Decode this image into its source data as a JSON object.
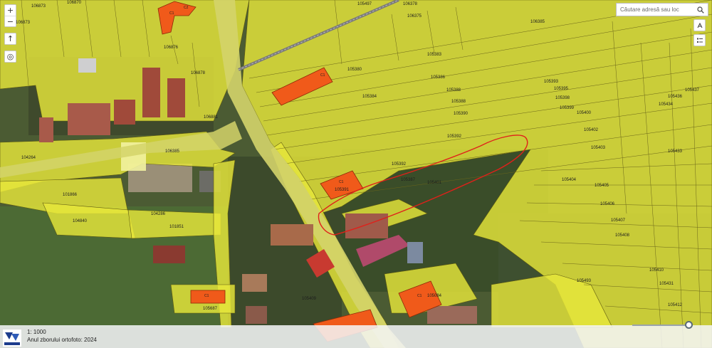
{
  "toolbar": {
    "zoom_in": "+",
    "zoom_out": "−",
    "compass": "↑",
    "locate": "◎"
  },
  "search": {
    "placeholder": "Căutare adresă sau loc"
  },
  "icons": {
    "search": "search-icon",
    "share": "share-icon",
    "layers": "layer-list-icon",
    "logo": "ancpi-logo"
  },
  "bottom_bar": {
    "scale": "1: 1000",
    "ortho_year": "Anul zborului ortofoto: 2024"
  },
  "map": {
    "colors": {
      "parcel_fill": "#e6e63a",
      "parcel_stroke": "#5f5a10",
      "building_fill": "#f05a1a",
      "building_stroke": "#8c2a08",
      "selection": "#e0201a",
      "railway": "#7a7a7a"
    },
    "parcel_labels": [
      {
        "id": "p01",
        "text": "106873"
      },
      {
        "id": "p02",
        "text": "106870"
      },
      {
        "id": "p03",
        "text": "106873"
      },
      {
        "id": "p04",
        "text": "106876"
      },
      {
        "id": "p05",
        "text": "106878"
      },
      {
        "id": "p06",
        "text": "106881"
      },
      {
        "id": "p07",
        "text": "106385"
      },
      {
        "id": "p08",
        "text": "104264"
      },
      {
        "id": "p09",
        "text": "105497"
      },
      {
        "id": "p10",
        "text": "106378"
      },
      {
        "id": "p11",
        "text": "106375"
      },
      {
        "id": "p12",
        "text": "106385"
      },
      {
        "id": "p13",
        "text": "105383"
      },
      {
        "id": "p14",
        "text": "105380"
      },
      {
        "id": "p15",
        "text": "105386"
      },
      {
        "id": "p16",
        "text": "105384"
      },
      {
        "id": "p17",
        "text": "105388"
      },
      {
        "id": "p18",
        "text": "105388"
      },
      {
        "id": "p19",
        "text": "105390"
      },
      {
        "id": "p20",
        "text": "105392"
      },
      {
        "id": "p21",
        "text": "105392"
      },
      {
        "id": "p22",
        "text": "105391"
      },
      {
        "id": "p23",
        "text": "105387"
      },
      {
        "id": "p24",
        "text": "105401"
      },
      {
        "id": "p25",
        "text": "105393"
      },
      {
        "id": "p26",
        "text": "105395"
      },
      {
        "id": "p27",
        "text": "105398"
      },
      {
        "id": "p28",
        "text": "105399"
      },
      {
        "id": "p29",
        "text": "105400"
      },
      {
        "id": "p30",
        "text": "105402"
      },
      {
        "id": "p31",
        "text": "105403"
      },
      {
        "id": "p32",
        "text": "105404"
      },
      {
        "id": "p33",
        "text": "105405"
      },
      {
        "id": "p34",
        "text": "105406"
      },
      {
        "id": "p35",
        "text": "105407"
      },
      {
        "id": "p36",
        "text": "105408"
      },
      {
        "id": "p37",
        "text": "105410"
      },
      {
        "id": "p38",
        "text": "105433"
      },
      {
        "id": "p39",
        "text": "105434"
      },
      {
        "id": "p40",
        "text": "105436"
      },
      {
        "id": "p41",
        "text": "105437"
      },
      {
        "id": "p42",
        "text": "101866"
      },
      {
        "id": "p43",
        "text": "104286"
      },
      {
        "id": "p44",
        "text": "101851"
      },
      {
        "id": "p45",
        "text": "104840"
      },
      {
        "id": "p46",
        "text": "105687"
      },
      {
        "id": "p47",
        "text": "105084"
      },
      {
        "id": "p48",
        "text": "105493"
      },
      {
        "id": "p49",
        "text": "105409"
      },
      {
        "id": "p50",
        "text": "105431"
      },
      {
        "id": "p51",
        "text": "105412"
      }
    ],
    "building_labels": [
      {
        "id": "b01",
        "text": "C1"
      },
      {
        "id": "b02",
        "text": "C2"
      },
      {
        "id": "b03",
        "text": "C1"
      },
      {
        "id": "b04",
        "text": "C1"
      },
      {
        "id": "b05",
        "text": "C1"
      },
      {
        "id": "b06",
        "text": "C1"
      }
    ]
  }
}
